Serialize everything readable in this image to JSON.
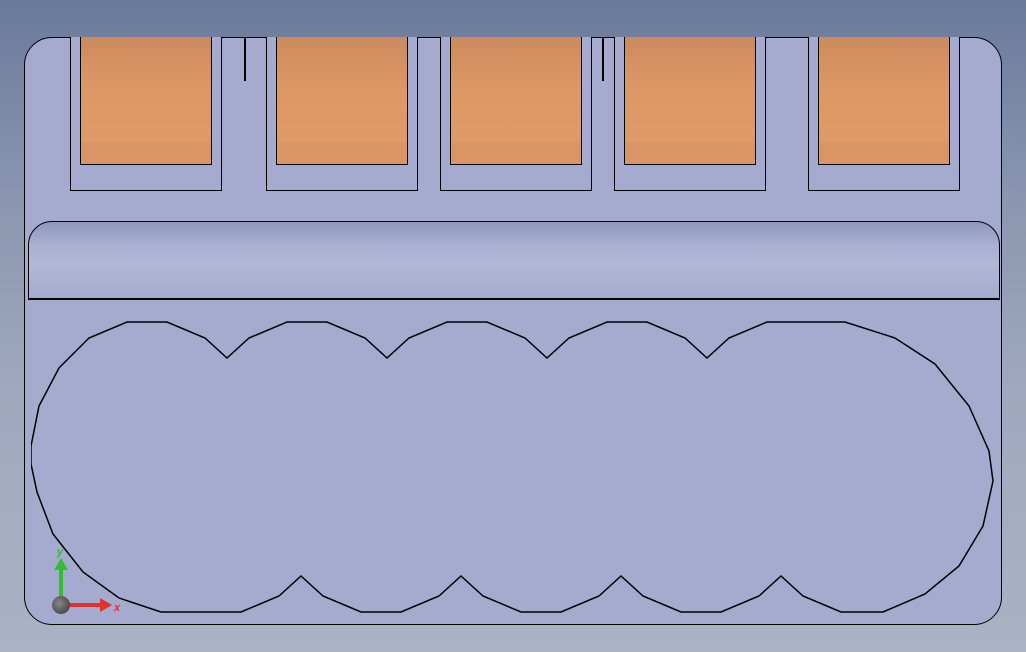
{
  "viewport": {
    "axis_x_label": "x",
    "axis_y_label": "y"
  },
  "colors": {
    "body_fill": "#a4abce",
    "orange_fill": "#dd9866",
    "axis_x": "#e03030",
    "axis_y": "#30c030"
  },
  "geometry": {
    "slot_count": 5,
    "cylinder_lobes": 5
  }
}
